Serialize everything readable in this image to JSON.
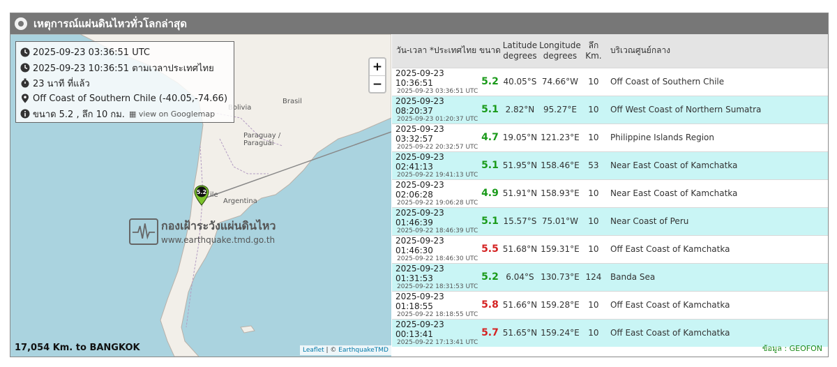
{
  "title": "เหตุการณ์แผ่นดินไหวทั่วโลกล่าสุด",
  "info": {
    "utc_time": "2025-09-23 03:36:51 UTC",
    "thai_time": "2025-09-23 10:36:51 ตามเวลาประเทศไทย",
    "ago": "23 นาที ที่แล้ว",
    "location": "Off Coast of Southern Chile (-40.05,-74.66)",
    "magdepth": "ขนาด 5.2 , ลึก 10 กม.",
    "map_link": "view on Googlemap"
  },
  "map": {
    "zoom_in": "+",
    "zoom_out": "−",
    "marker_mag": "5.2",
    "labels": {
      "bolivia": "Bolivia",
      "brasil": "Brasil",
      "paraguay": "Paraguay / Paraguái",
      "chile": "ile",
      "argentina": "Argentina"
    },
    "watermark_title": "กองเฝ้าระวังแผ่นดินไหว",
    "watermark_url": "www.earthquake.tmd.go.th",
    "distance": "17,054 Km. to BANGKOK",
    "attrib_leaflet": "Leaflet",
    "attrib_sep": " | © ",
    "attrib_tmd": "EarthquakeTMD"
  },
  "table": {
    "headers": {
      "datetime": "วัน-เวลา *ประเทศไทย",
      "mag": "ขนาด",
      "lat1": "Latitude",
      "lat2": "degrees",
      "lon1": "Longitude",
      "lon2": "degrees",
      "dep1": "ลึก",
      "dep2": "Km.",
      "region": "บริเวณศูนย์กลาง"
    },
    "rows": [
      {
        "th": "2025-09-23 10:36:51",
        "utc": "2025-09-23 03:36:51 UTC",
        "mag": "5.2",
        "lat": "40.05°S",
        "lon": "74.66°W",
        "dep": "10",
        "region": "Off Coast of Southern Chile"
      },
      {
        "th": "2025-09-23 08:20:37",
        "utc": "2025-09-23 01:20:37 UTC",
        "mag": "5.1",
        "lat": "2.82°N",
        "lon": "95.27°E",
        "dep": "10",
        "region": "Off West Coast of Northern Sumatra"
      },
      {
        "th": "2025-09-23 03:32:57",
        "utc": "2025-09-22 20:32:57 UTC",
        "mag": "4.7",
        "lat": "19.05°N",
        "lon": "121.23°E",
        "dep": "10",
        "region": "Philippine Islands Region"
      },
      {
        "th": "2025-09-23 02:41:13",
        "utc": "2025-09-22 19:41:13 UTC",
        "mag": "5.1",
        "lat": "51.95°N",
        "lon": "158.46°E",
        "dep": "53",
        "region": "Near East Coast of Kamchatka"
      },
      {
        "th": "2025-09-23 02:06:28",
        "utc": "2025-09-22 19:06:28 UTC",
        "mag": "4.9",
        "lat": "51.91°N",
        "lon": "158.93°E",
        "dep": "10",
        "region": "Near East Coast of Kamchatka"
      },
      {
        "th": "2025-09-23 01:46:39",
        "utc": "2025-09-22 18:46:39 UTC",
        "mag": "5.1",
        "lat": "15.57°S",
        "lon": "75.01°W",
        "dep": "10",
        "region": "Near Coast of Peru"
      },
      {
        "th": "2025-09-23 01:46:30",
        "utc": "2025-09-22 18:46:30 UTC",
        "mag": "5.5",
        "lat": "51.68°N",
        "lon": "159.31°E",
        "dep": "10",
        "region": "Off East Coast of Kamchatka"
      },
      {
        "th": "2025-09-23 01:31:53",
        "utc": "2025-09-22 18:31:53 UTC",
        "mag": "5.2",
        "lat": "6.04°S",
        "lon": "130.73°E",
        "dep": "124",
        "region": "Banda Sea"
      },
      {
        "th": "2025-09-23 01:18:55",
        "utc": "2025-09-22 18:18:55 UTC",
        "mag": "5.8",
        "lat": "51.66°N",
        "lon": "159.28°E",
        "dep": "10",
        "region": "Off East Coast of Kamchatka"
      },
      {
        "th": "2025-09-23 00:13:41",
        "utc": "2025-09-22 17:13:41 UTC",
        "mag": "5.7",
        "lat": "51.65°N",
        "lon": "159.24°E",
        "dep": "10",
        "region": "Off East Coast of Kamchatka"
      }
    ]
  },
  "source": "ข้อมูล : GEOFON",
  "colors": {
    "mag_low": "#1a9a1a",
    "mag_high": "#d42222",
    "row_alt": "#c9f5f5",
    "header_bg": "#777777"
  }
}
